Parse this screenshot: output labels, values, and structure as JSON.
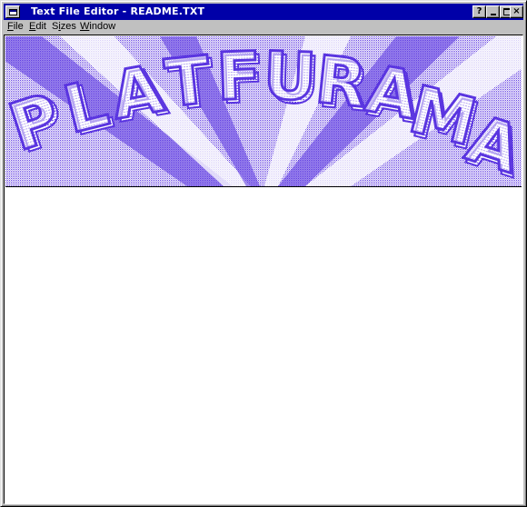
{
  "window": {
    "title": "Text File Editor - README.TXT",
    "buttons": {
      "help": "?",
      "close": "×"
    }
  },
  "menu": {
    "file": {
      "underline": "F",
      "rest": "ile"
    },
    "edit": {
      "underline": "E",
      "rest": "dit"
    },
    "sizes": {
      "prefix": "S",
      "underline": "i",
      "rest": "zes"
    },
    "window": {
      "underline": "W",
      "rest": "indow"
    }
  },
  "banner": {
    "logo_text": "PLATFURAMA",
    "colors": {
      "primary": "#5a35e0",
      "light": "#b8a6f0",
      "background": "#ffffff"
    }
  },
  "colors": {
    "titlebar": "#0000a8",
    "chrome": "#c0c0c0",
    "editor_background": "#ffffff"
  }
}
